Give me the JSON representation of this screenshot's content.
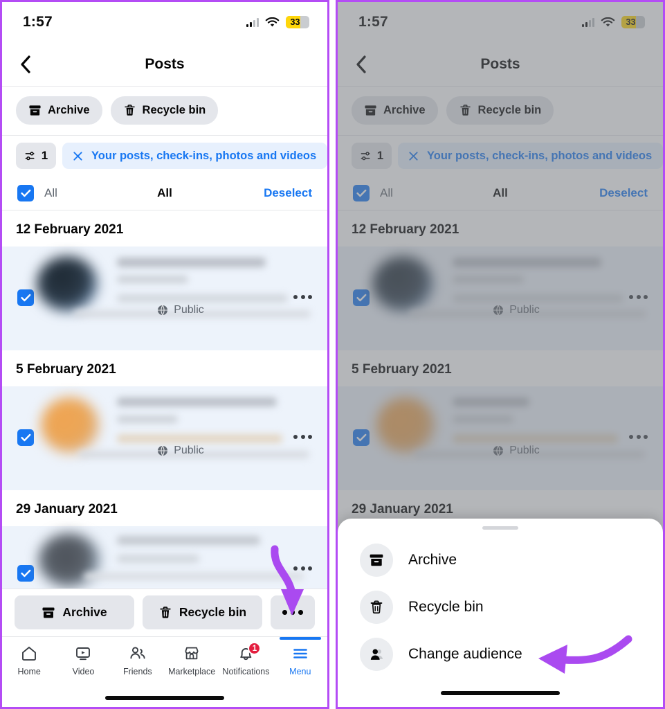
{
  "status_bar": {
    "time": "1:57",
    "battery_level": "33",
    "battery_color": "#ffd60a"
  },
  "nav": {
    "title": "Posts",
    "back_icon": "chevron-left-icon"
  },
  "header_chips": [
    {
      "label": "Archive",
      "icon": "archive-box-icon"
    },
    {
      "label": "Recycle bin",
      "icon": "trash-icon"
    }
  ],
  "filter": {
    "count": "1",
    "filter_icon": "sliders-icon",
    "pill_label": "Your posts, check-ins, photos and videos",
    "clear_icon": "close-x-icon"
  },
  "select_row": {
    "all_label": "All",
    "center_label": "All",
    "deselect_label": "Deselect",
    "checked": true
  },
  "posts": [
    {
      "date": "12 February 2021",
      "privacy": "Public",
      "privacy_icon": "globe-icon",
      "checked": true,
      "more_icon": "more-horizontal-icon",
      "avatar_color": "#2c3a47"
    },
    {
      "date": "5 February 2021",
      "privacy": "Public",
      "privacy_icon": "globe-icon",
      "checked": true,
      "more_icon": "more-horizontal-icon",
      "avatar_color": "#e8a253"
    },
    {
      "date": "29 January 2021",
      "privacy": "",
      "privacy_icon": "globe-icon",
      "checked": true,
      "more_icon": "more-horizontal-icon",
      "avatar_color": "#4a4f56"
    }
  ],
  "action_bar": [
    {
      "label": "Archive",
      "icon": "archive-box-icon"
    },
    {
      "label": "Recycle bin",
      "icon": "trash-icon"
    },
    {
      "label": "",
      "icon": "more-horizontal-icon"
    }
  ],
  "tab_bar": [
    {
      "label": "Home",
      "icon": "home-icon",
      "active": false,
      "badge": ""
    },
    {
      "label": "Video",
      "icon": "video-icon",
      "active": false,
      "badge": ""
    },
    {
      "label": "Friends",
      "icon": "friends-icon",
      "active": false,
      "badge": ""
    },
    {
      "label": "Marketplace",
      "icon": "marketplace-icon",
      "active": false,
      "badge": ""
    },
    {
      "label": "Notifications",
      "icon": "bell-icon",
      "active": false,
      "badge": "1"
    },
    {
      "label": "Menu",
      "icon": "hamburger-menu-icon",
      "active": true,
      "badge": ""
    }
  ],
  "bottom_sheet": {
    "grabber": "sheet-grabber",
    "items": [
      {
        "label": "Archive",
        "icon": "archive-box-icon"
      },
      {
        "label": "Recycle bin",
        "icon": "trash-icon"
      },
      {
        "label": "Change audience",
        "icon": "change-audience-person-icon"
      }
    ]
  },
  "annotations": {
    "arrow_color": "#aa4af0",
    "left_arrow": "curved-arrow-down-to-more-button",
    "right_arrow": "curved-arrow-left-to-change-audience"
  },
  "colors": {
    "accent_blue": "#1877f2",
    "selected_row_bg": "#edf3fb",
    "chip_bg": "#e4e6eb",
    "frame_purple": "#b44cf5",
    "badge_red": "#e41e3f"
  }
}
